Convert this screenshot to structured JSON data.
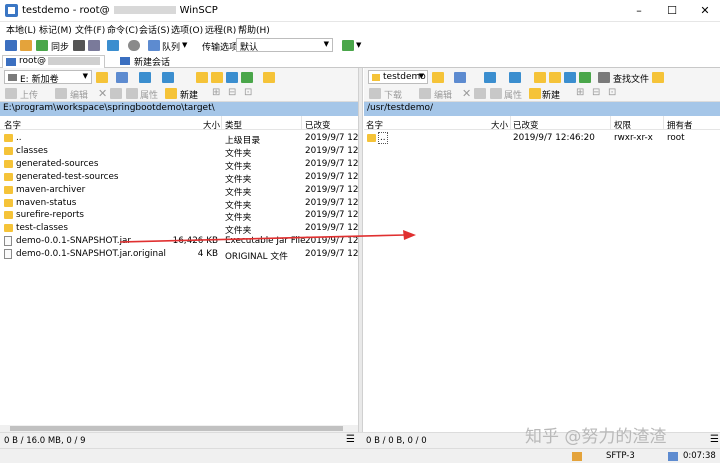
{
  "window": {
    "title_left": "testdemo - root@",
    "title_right": "WinSCP",
    "min": "–",
    "max": "☐",
    "close": "✕"
  },
  "menu": [
    "本地(L)",
    "标记(M)",
    "文件(F)",
    "命令(C)",
    "会话(S)",
    "选项(O)",
    "远程(R)",
    "帮助(H)"
  ],
  "toolbar": {
    "sync_label": "同步",
    "queue_label": "队列",
    "transfer_settings_label": "传输选项",
    "transfer_settings_value": "默认"
  },
  "tabs": {
    "session_label": "root@",
    "new_session_label": "新建会话"
  },
  "left_panel": {
    "drive_value": "E: 新加卷",
    "upload_label": "上传",
    "edit_label": "编辑",
    "properties_label": "属性",
    "new_label": "新建",
    "path": "E:\\program\\workspace\\springbootdemo\\target\\",
    "columns": {
      "name": "名字",
      "size": "大小",
      "type": "类型",
      "changed": "已改变"
    },
    "rows": [
      {
        "name": "..",
        "size": "",
        "type": "上级目录",
        "changed": "2019/9/7  12:",
        "kind": "parent"
      },
      {
        "name": "classes",
        "size": "",
        "type": "文件夹",
        "changed": "2019/9/7  12:",
        "kind": "folder"
      },
      {
        "name": "generated-sources",
        "size": "",
        "type": "文件夹",
        "changed": "2019/9/7  12:",
        "kind": "folder"
      },
      {
        "name": "generated-test-sources",
        "size": "",
        "type": "文件夹",
        "changed": "2019/9/7  12:",
        "kind": "folder"
      },
      {
        "name": "maven-archiver",
        "size": "",
        "type": "文件夹",
        "changed": "2019/9/7  12:",
        "kind": "folder"
      },
      {
        "name": "maven-status",
        "size": "",
        "type": "文件夹",
        "changed": "2019/9/7  12:",
        "kind": "folder"
      },
      {
        "name": "surefire-reports",
        "size": "",
        "type": "文件夹",
        "changed": "2019/9/7  12:",
        "kind": "folder"
      },
      {
        "name": "test-classes",
        "size": "",
        "type": "文件夹",
        "changed": "2019/9/7  12:",
        "kind": "folder"
      },
      {
        "name": "demo-0.0.1-SNAPSHOT.jar",
        "size": "16,426 KB",
        "type": "Executable Jar File",
        "changed": "2019/9/7  12:",
        "kind": "file"
      },
      {
        "name": "demo-0.0.1-SNAPSHOT.jar.original",
        "size": "4 KB",
        "type": "ORIGINAL 文件",
        "changed": "2019/9/7  12:",
        "kind": "file"
      }
    ],
    "status": "0 B / 16.0 MB,   0 / 9"
  },
  "right_panel": {
    "dir_value": "testdemo",
    "find_files_label": "查找文件",
    "download_label": "下载",
    "edit_label": "编辑",
    "properties_label": "属性",
    "new_label": "新建",
    "path": "/usr/testdemo/",
    "columns": {
      "name": "名字",
      "size": "大小",
      "changed": "已改变",
      "rights": "权限",
      "owner": "拥有者"
    },
    "rows": [
      {
        "name": "..",
        "size": "",
        "changed": "2019/9/7 12:46:20",
        "rights": "rwxr-xr-x",
        "owner": "root",
        "kind": "parent"
      }
    ],
    "status": "0 B / 0 B,   0 / 0"
  },
  "bottom": {
    "protocol": "SFTP-3",
    "timer": "0:07:38"
  },
  "watermark": "知乎 @努力的渣渣",
  "colors": {
    "path_bar": "#a5c6e8",
    "folder": "#f5c338",
    "annotation_arrow": "#e03030"
  }
}
